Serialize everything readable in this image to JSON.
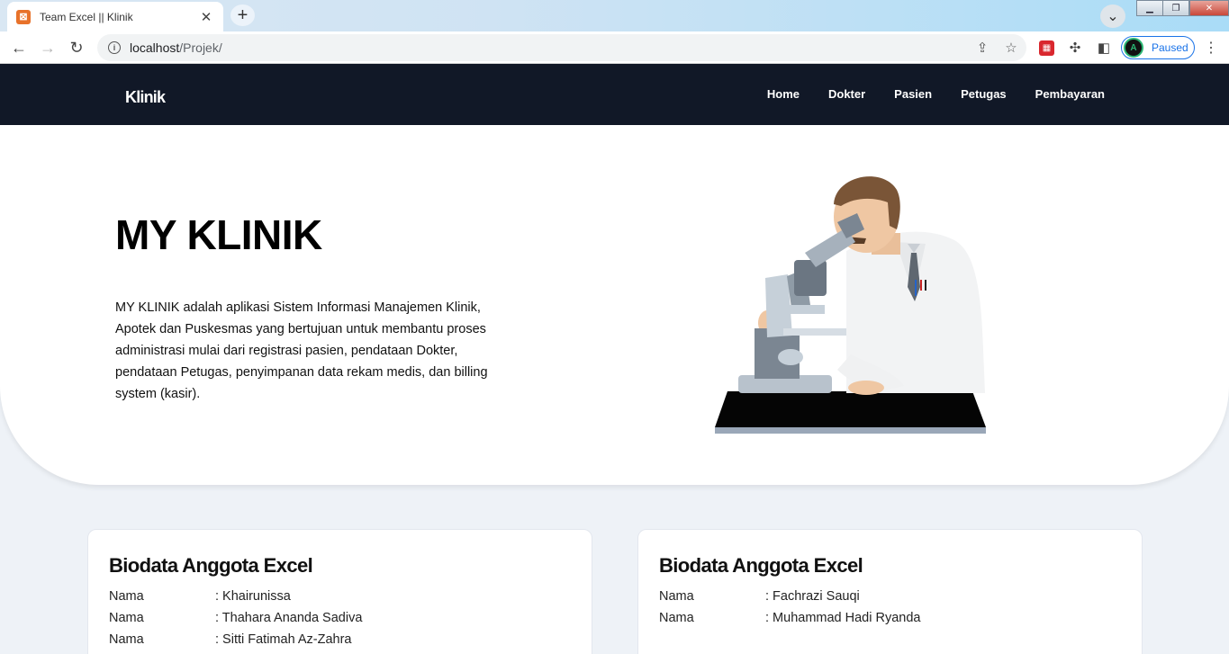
{
  "browser": {
    "tab_title": "Team Excel || Klinik",
    "favicon_glyph": "⊠",
    "url_host": "localhost",
    "url_path": "/Projek/",
    "profile_status": "Paused"
  },
  "navbar": {
    "brand": "Klinik",
    "items": [
      "Home",
      "Dokter",
      "Pasien",
      "Petugas",
      "Pembayaran"
    ]
  },
  "hero": {
    "title": "MY KLINIK",
    "description": "MY KLINIK adalah aplikasi Sistem Informasi Manajemen Klinik, Apotek dan Puskesmas yang bertujuan untuk membantu proses administrasi mulai dari registrasi pasien, pendataan Dokter, pendataan Petugas, penyimpanan data rekam medis, dan billing system (kasir).",
    "illustration": "doctor-with-microscope-illustration"
  },
  "cards": [
    {
      "title": "Biodata Anggota Excel",
      "rows": [
        {
          "label": "Nama",
          "value": ": Khairunissa"
        },
        {
          "label": "Nama",
          "value": ": Thahara Ananda Sadiva"
        },
        {
          "label": "Nama",
          "value": ": Sitti Fatimah Az-Zahra"
        }
      ]
    },
    {
      "title": "Biodata Anggota Excel",
      "rows": [
        {
          "label": "Nama",
          "value": ": Fachrazi Sauqi"
        },
        {
          "label": "Nama",
          "value": ": Muhammad Hadi Ryanda"
        }
      ]
    }
  ],
  "colors": {
    "navbar_bg": "#111827",
    "page_bg": "#eef2f7",
    "accent": "#1a73e8"
  }
}
